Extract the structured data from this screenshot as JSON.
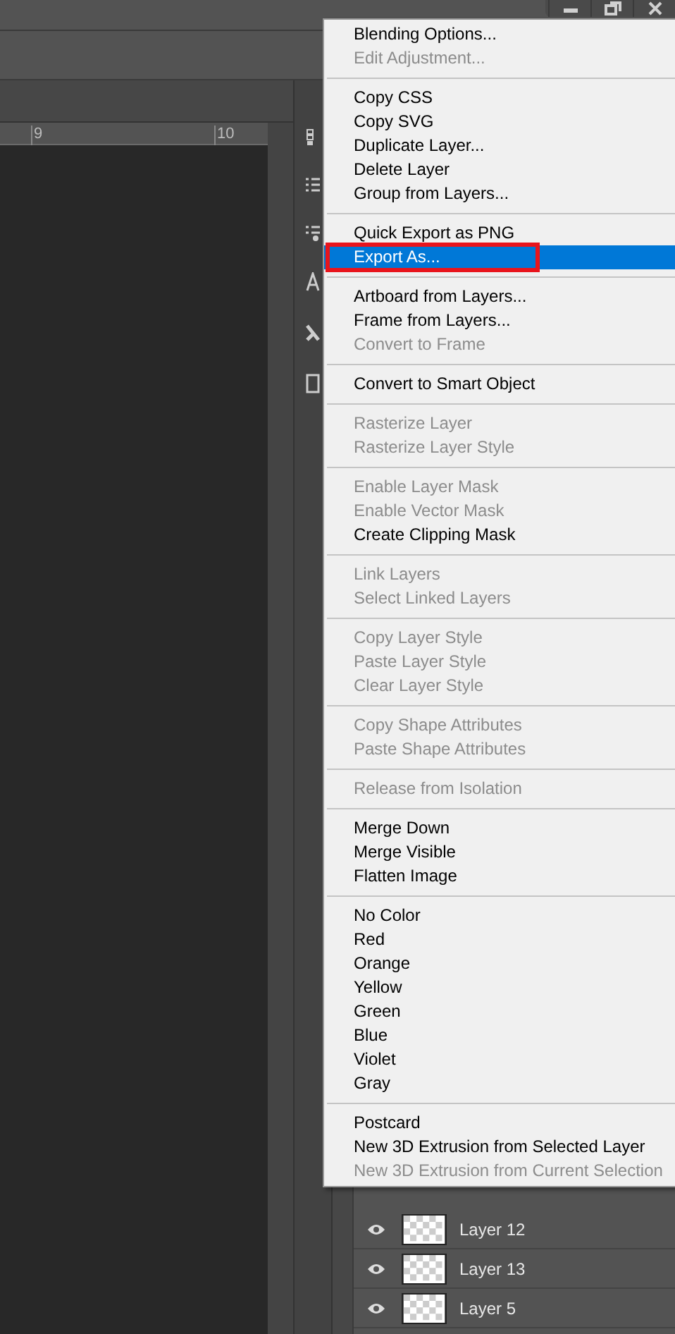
{
  "window_controls": [
    {
      "kind": "minimize"
    },
    {
      "kind": "restore"
    },
    {
      "kind": "close"
    }
  ],
  "ruler": {
    "labels": [
      "9",
      "10"
    ]
  },
  "context_menu": {
    "sections": [
      [
        {
          "label": "Blending Options...",
          "disabled": false,
          "selected": false
        },
        {
          "label": "Edit Adjustment...",
          "disabled": true,
          "selected": false
        }
      ],
      [
        {
          "label": "Copy CSS",
          "disabled": false,
          "selected": false
        },
        {
          "label": "Copy SVG",
          "disabled": false,
          "selected": false
        },
        {
          "label": "Duplicate Layer...",
          "disabled": false,
          "selected": false
        },
        {
          "label": "Delete Layer",
          "disabled": false,
          "selected": false
        },
        {
          "label": "Group from Layers...",
          "disabled": false,
          "selected": false
        }
      ],
      [
        {
          "label": "Quick Export as PNG",
          "disabled": false,
          "selected": false
        },
        {
          "label": "Export As...",
          "disabled": false,
          "selected": true,
          "outlined": true
        }
      ],
      [
        {
          "label": "Artboard from Layers...",
          "disabled": false,
          "selected": false
        },
        {
          "label": "Frame from Layers...",
          "disabled": false,
          "selected": false
        },
        {
          "label": "Convert to Frame",
          "disabled": true,
          "selected": false
        }
      ],
      [
        {
          "label": "Convert to Smart Object",
          "disabled": false,
          "selected": false
        }
      ],
      [
        {
          "label": "Rasterize Layer",
          "disabled": true,
          "selected": false
        },
        {
          "label": "Rasterize Layer Style",
          "disabled": true,
          "selected": false
        }
      ],
      [
        {
          "label": "Enable Layer Mask",
          "disabled": true,
          "selected": false
        },
        {
          "label": "Enable Vector Mask",
          "disabled": true,
          "selected": false
        },
        {
          "label": "Create Clipping Mask",
          "disabled": false,
          "selected": false
        }
      ],
      [
        {
          "label": "Link Layers",
          "disabled": true,
          "selected": false
        },
        {
          "label": "Select Linked Layers",
          "disabled": true,
          "selected": false
        }
      ],
      [
        {
          "label": "Copy Layer Style",
          "disabled": true,
          "selected": false
        },
        {
          "label": "Paste Layer Style",
          "disabled": true,
          "selected": false
        },
        {
          "label": "Clear Layer Style",
          "disabled": true,
          "selected": false
        }
      ],
      [
        {
          "label": "Copy Shape Attributes",
          "disabled": true,
          "selected": false
        },
        {
          "label": "Paste Shape Attributes",
          "disabled": true,
          "selected": false
        }
      ],
      [
        {
          "label": "Release from Isolation",
          "disabled": true,
          "selected": false
        }
      ],
      [
        {
          "label": "Merge Down",
          "disabled": false,
          "selected": false
        },
        {
          "label": "Merge Visible",
          "disabled": false,
          "selected": false
        },
        {
          "label": "Flatten Image",
          "disabled": false,
          "selected": false
        }
      ],
      [
        {
          "label": "No Color",
          "disabled": false,
          "selected": false
        },
        {
          "label": "Red",
          "disabled": false,
          "selected": false
        },
        {
          "label": "Orange",
          "disabled": false,
          "selected": false
        },
        {
          "label": "Yellow",
          "disabled": false,
          "selected": false
        },
        {
          "label": "Green",
          "disabled": false,
          "selected": false
        },
        {
          "label": "Blue",
          "disabled": false,
          "selected": false
        },
        {
          "label": "Violet",
          "disabled": false,
          "selected": false
        },
        {
          "label": "Gray",
          "disabled": false,
          "selected": false
        }
      ],
      [
        {
          "label": "Postcard",
          "disabled": false,
          "selected": false
        },
        {
          "label": "New 3D Extrusion from Selected Layer",
          "disabled": false,
          "selected": false
        },
        {
          "label": "New 3D Extrusion from Current Selection",
          "disabled": true,
          "selected": false
        }
      ]
    ]
  },
  "layers": [
    {
      "name": "Layer 12",
      "visible": true
    },
    {
      "name": "Layer 13",
      "visible": true
    },
    {
      "name": "Layer 5",
      "visible": true
    }
  ]
}
